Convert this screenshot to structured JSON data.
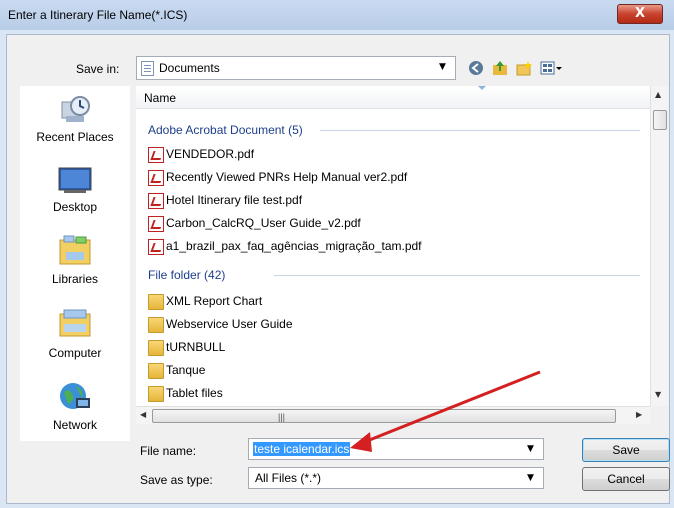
{
  "dialog": {
    "title": "Enter a Itinerary File Name(*.ICS)",
    "close_glyph": "X"
  },
  "save_in": {
    "label": "Save in:",
    "location": "Documents"
  },
  "toolbar": {
    "icons": [
      "back-icon",
      "up-folder-icon",
      "new-folder-icon",
      "views-menu-icon"
    ]
  },
  "places": [
    {
      "label": "Recent Places",
      "icon": "recent-places-icon"
    },
    {
      "label": "Desktop",
      "icon": "desktop-icon"
    },
    {
      "label": "Libraries",
      "icon": "libraries-icon"
    },
    {
      "label": "Computer",
      "icon": "computer-icon"
    },
    {
      "label": "Network",
      "icon": "network-icon"
    }
  ],
  "filelist": {
    "column_name": "Name",
    "groups": [
      {
        "title": "Adobe Acrobat Document (5)",
        "items": [
          "VENDEDOR.pdf",
          "Recently Viewed PNRs Help Manual ver2.pdf",
          "Hotel Itinerary file test.pdf",
          "Carbon_CalcRQ_User Guide_v2.pdf",
          "a1_brazil_pax_faq_agências_migração_tam.pdf"
        ]
      },
      {
        "title": "File folder (42)",
        "items": [
          "XML Report Chart",
          "Webservice User Guide",
          "tURNBULL",
          "Tanque",
          "Tablet files"
        ]
      }
    ]
  },
  "file_name": {
    "label": "File name:",
    "value": "teste icalendar.ics"
  },
  "save_as_type": {
    "label": "Save as type:",
    "value": "All Files (*.*)"
  },
  "buttons": {
    "save": "Save",
    "cancel": "Cancel"
  },
  "colors": {
    "annotation_arrow": "#d42020",
    "selection": "#3399ff",
    "group_header": "#1e3f8a"
  }
}
